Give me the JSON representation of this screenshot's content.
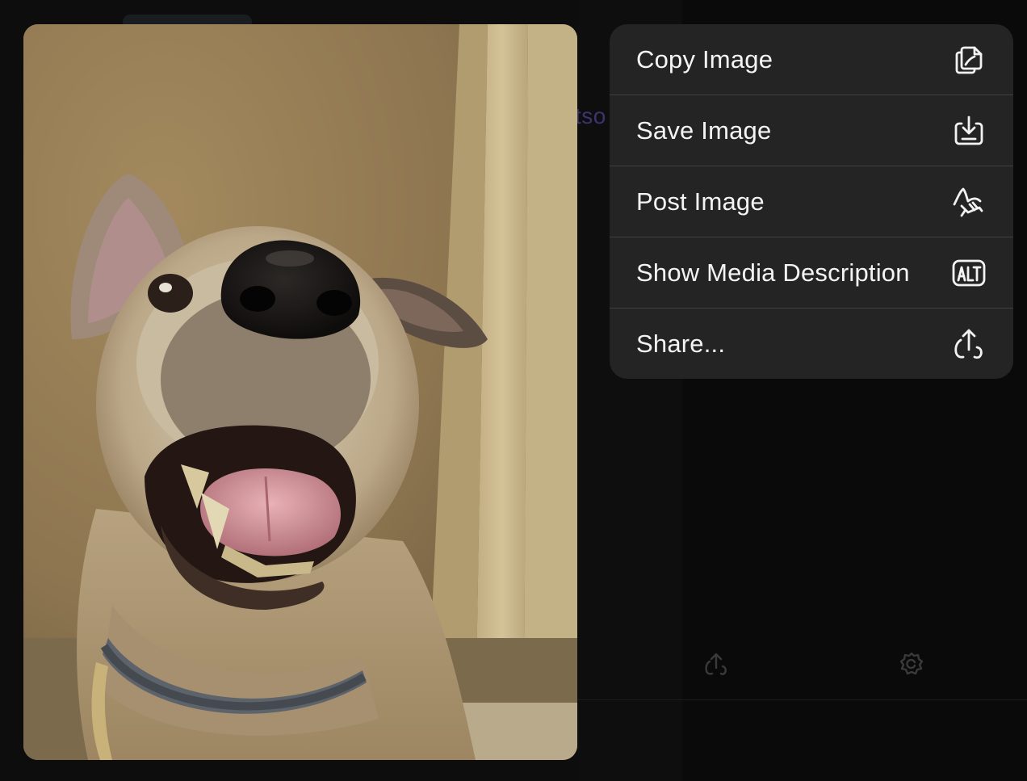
{
  "background": {
    "partial_text": "tso"
  },
  "photo": {
    "subject": "dog-photo"
  },
  "menu": {
    "items": [
      {
        "label": "Copy Image",
        "icon": "copy-image-icon"
      },
      {
        "label": "Save Image",
        "icon": "save-image-icon"
      },
      {
        "label": "Post Image",
        "icon": "post-image-icon"
      },
      {
        "label": "Show Media Description",
        "icon": "alt-text-icon"
      },
      {
        "label": "Share...",
        "icon": "share-icon"
      }
    ]
  },
  "colors": {
    "menu_bg": "#242424",
    "menu_text": "#f4f4f4",
    "separator": "#3f3f3f",
    "screen_bg": "#0c0d0c",
    "link_accent": "#3c3470"
  }
}
